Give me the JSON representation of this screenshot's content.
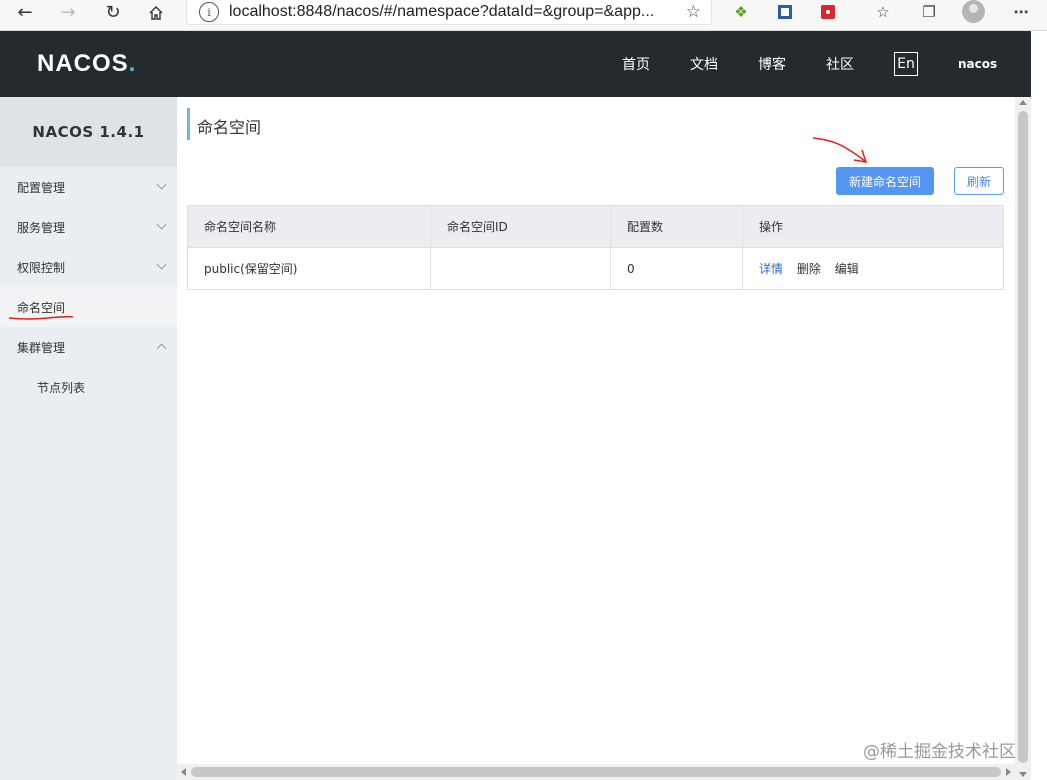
{
  "browser": {
    "url": "localhost:8848/nacos/#/namespace?dataId=&group=&app...",
    "info_glyph": "i",
    "back_icon": "back-arrow-icon",
    "forward_icon": "forward-arrow-icon",
    "refresh_icon": "refresh-icon",
    "home_icon": "home-icon"
  },
  "header": {
    "logo": "NACOS",
    "logo_dot": ".",
    "nav": [
      "首页",
      "文档",
      "博客",
      "社区"
    ],
    "lang": "En",
    "user": "nacos"
  },
  "sidebar": {
    "title": "NACOS 1.4.1",
    "items": [
      {
        "label": "配置管理"
      },
      {
        "label": "服务管理"
      },
      {
        "label": "权限控制"
      },
      {
        "label": "命名空间"
      },
      {
        "label": "集群管理"
      },
      {
        "label": "节点列表"
      }
    ]
  },
  "main": {
    "title": "命名空间",
    "new_button": "新建命名空间",
    "refresh_button": "刷新",
    "table": {
      "headers": [
        "命名空间名称",
        "命名空间ID",
        "配置数",
        "操作"
      ],
      "rows": [
        {
          "name": "public(保留空间)",
          "id": "",
          "count": "0",
          "ops": [
            "详情",
            "删除",
            "编辑"
          ]
        }
      ]
    }
  },
  "watermark": "@稀土掘金技术社区",
  "colors": {
    "topnav_bg": "#252a2f",
    "primary": "#5596f2",
    "annotation": "#e02020"
  }
}
